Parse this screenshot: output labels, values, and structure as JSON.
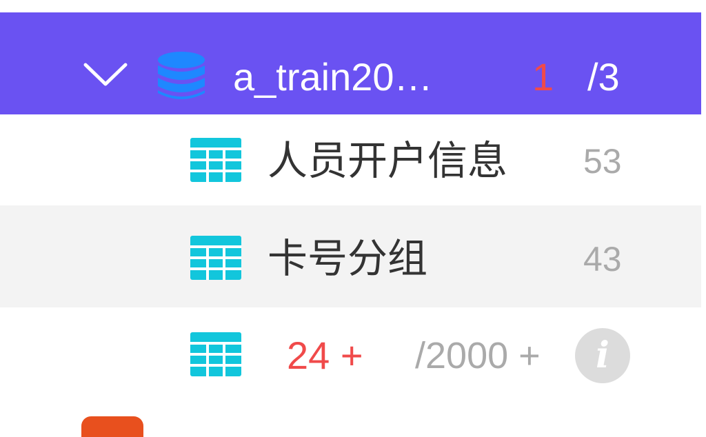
{
  "database": {
    "name": "a_train20…",
    "selected_count": "1",
    "total_count": "/3",
    "icon": "database-icon",
    "expand_icon": "chevron-down-icon"
  },
  "tables": [
    {
      "label": "人员开户信息",
      "count": "53",
      "icon": "table-icon"
    },
    {
      "label": "卡号分组",
      "count": "43",
      "icon": "table-icon"
    }
  ],
  "more_row": {
    "count": "24 +",
    "total": "/2000 +",
    "info_icon": "info-icon",
    "info_glyph": "i"
  },
  "colors": {
    "header_bg": "#6a52f2",
    "highlight_red": "#f04a4a",
    "table_icon": "#12c6dc",
    "database_icon": "#1e88ff",
    "hover_row_bg": "#f3f3f3",
    "muted_text": "#aaaaaa",
    "next_item_icon": "#e8501e"
  }
}
